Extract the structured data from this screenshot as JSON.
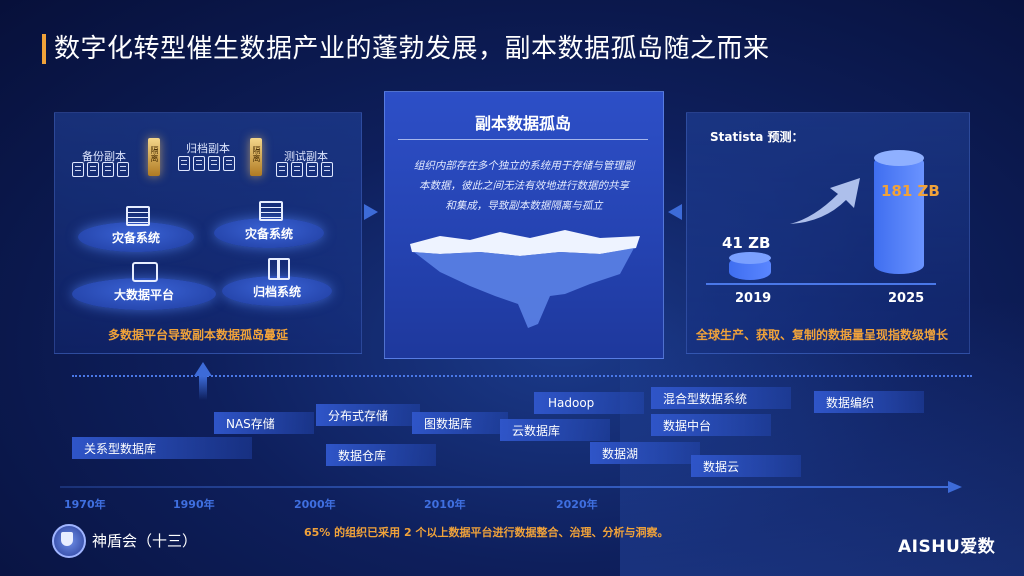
{
  "title": "数字化转型催生数据产业的蓬勃发展，副本数据孤岛随之而来",
  "left_panel": {
    "groups": [
      {
        "label": "备份副本"
      },
      {
        "label": "归档副本"
      },
      {
        "label": "测试副本"
      }
    ],
    "separator_text": "隔离",
    "nodes": [
      {
        "label": "灾备系统"
      },
      {
        "label": "灾备系统"
      },
      {
        "label": "大数据平台"
      },
      {
        "label": "归档系统"
      }
    ],
    "caption": "多数据平台导致副本数据孤岛蔓延"
  },
  "center_panel": {
    "heading": "副本数据孤岛",
    "description_lines": [
      "组织内部存在多个独立的系统用于存储与管理副",
      "本数据，彼此之间无法有效地进行数据的共享",
      "和集成，导致副本数据隔离与孤立"
    ]
  },
  "right_panel": {
    "label": "Statista 预测：",
    "value_2019": "41 ZB",
    "value_2025": "181 ZB",
    "year_2019": "2019",
    "year_2025": "2025",
    "caption": "全球生产、获取、复制的数据量呈现指数级增长"
  },
  "timeline": {
    "items": [
      {
        "label": "关系型数据库"
      },
      {
        "label": "NAS存储"
      },
      {
        "label": "分布式存储"
      },
      {
        "label": "数据仓库"
      },
      {
        "label": "图数据库"
      },
      {
        "label": "Hadoop"
      },
      {
        "label": "云数据库"
      },
      {
        "label": "混合型数据系统"
      },
      {
        "label": "数据中台"
      },
      {
        "label": "数据湖"
      },
      {
        "label": "数据云"
      },
      {
        "label": "数据编织"
      }
    ],
    "years": [
      "1970年",
      "1990年",
      "2000年",
      "2010年",
      "2020年"
    ]
  },
  "footer": {
    "org": "神盾会（十三）",
    "note": "65% 的组织已采用 2 个以上数据平台进行数据整合、治理、分析与洞察。",
    "brand": "AISHU爱数"
  }
}
